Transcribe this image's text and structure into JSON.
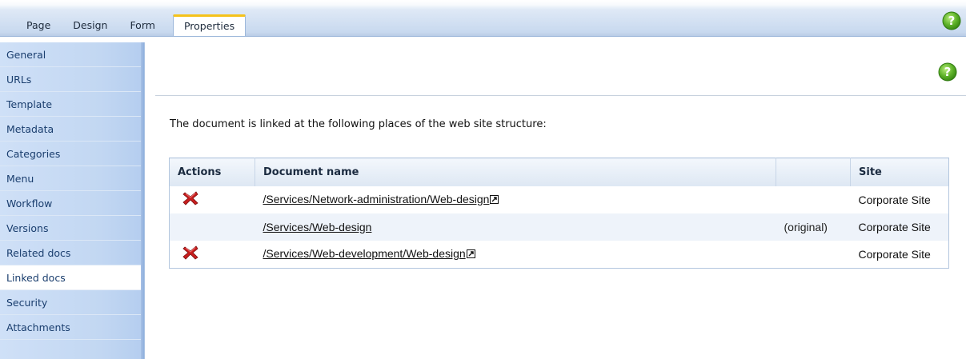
{
  "tabs": [
    {
      "label": "Page"
    },
    {
      "label": "Design"
    },
    {
      "label": "Form"
    },
    {
      "label": "Properties",
      "active": true
    }
  ],
  "sidebar": {
    "items": [
      {
        "label": "General"
      },
      {
        "label": "URLs"
      },
      {
        "label": "Template"
      },
      {
        "label": "Metadata"
      },
      {
        "label": "Categories"
      },
      {
        "label": "Menu"
      },
      {
        "label": "Workflow"
      },
      {
        "label": "Versions"
      },
      {
        "label": "Related docs"
      },
      {
        "label": "Linked docs",
        "selected": true
      },
      {
        "label": "Security"
      },
      {
        "label": "Attachments"
      }
    ]
  },
  "main": {
    "intro": "The document is linked at the following places of the web site structure:",
    "table": {
      "headers": {
        "actions": "Actions",
        "document_name": "Document name",
        "extra": "",
        "site": "Site"
      },
      "rows": [
        {
          "document": "/Services/Network-administration/Web-design",
          "note": "",
          "site": "Corporate Site",
          "deletable": true,
          "external_icon": true
        },
        {
          "document": "/Services/Web-design",
          "note": "(original)",
          "site": "Corporate Site",
          "deletable": false,
          "external_icon": false
        },
        {
          "document": "/Services/Web-development/Web-design",
          "note": "",
          "site": "Corporate Site",
          "deletable": true,
          "external_icon": true
        }
      ]
    }
  },
  "icons": {
    "help": "help-question-icon",
    "delete": "delete-x-icon",
    "external": "external-link-icon"
  },
  "colors": {
    "accent_tab": "#f5c21b",
    "help_green": "#5fb32a",
    "delete_red": "#c81e1e",
    "menu_bg": "#c2d7f2"
  }
}
